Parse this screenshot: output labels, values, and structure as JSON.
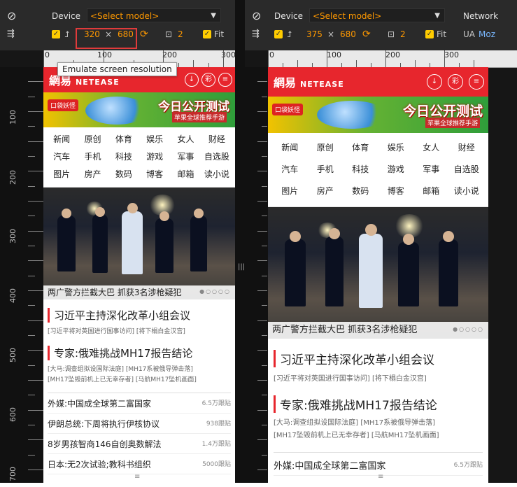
{
  "toolbar": {
    "device_label": "Device",
    "select_model": "<Select model>",
    "network_label": "Network",
    "ua_label": "UA",
    "ua_value": "Moz",
    "fit_label": "Fit",
    "times": "×"
  },
  "panes": [
    {
      "width": "320",
      "height": "680",
      "dpr": "2",
      "ruler_top": [
        "0",
        "100",
        "200",
        "300"
      ],
      "ruler_left": [
        "100",
        "200",
        "300",
        "400",
        "500",
        "600",
        "700"
      ]
    },
    {
      "width": "375",
      "height": "680",
      "dpr": "2",
      "ruler_top": [
        "0",
        "100",
        "200",
        "300"
      ],
      "ruler_left": [
        "100",
        "200",
        "300",
        "400",
        "500",
        "600",
        "700"
      ]
    }
  ],
  "tooltip": "Emulate screen resolution",
  "site": {
    "logo": "網易",
    "logo_en": "NETEASE",
    "header_icons": [
      "↓",
      "彩",
      "≡"
    ],
    "banner_title": "今日公开测试",
    "banner_sub": "苹果全球推荐手游",
    "banner_logo": "口袋妖怪",
    "nav": [
      "新闻",
      "原创",
      "体育",
      "娱乐",
      "女人",
      "财经",
      "汽车",
      "手机",
      "科技",
      "游戏",
      "军事",
      "自选股",
      "图片",
      "房产",
      "数码",
      "博客",
      "邮箱",
      "读小说"
    ],
    "photo_caption": "两广警方拦截大巴 抓获3名涉枪疑犯",
    "headline1": "习近平主持深化改革小组会议",
    "sub1": "[习近平将对英国进行国事访问] [将下榻白金汉宫]",
    "headline2": "专家:俄难挑战MH17报告结论",
    "sub2a": "[大马:调查组拟设国际法庭] [MH17系被俄导弹击落]",
    "sub2b": "[MH17坠毁前机上已无幸存者] [马航MH17坠机画面]",
    "list": [
      {
        "title": "外媒:中国成全球第二富国家",
        "count": "6.5万跟贴"
      },
      {
        "title": "伊朗总统:下周将执行伊核协议",
        "count": "938跟贴"
      },
      {
        "title": "8岁男孩智商146自创奥数解法",
        "count": "1.4万跟贴"
      },
      {
        "title": "日本:无2次试验;教科书组织",
        "count": "5000跟贴"
      }
    ]
  },
  "colors": {
    "brand_red": "#e7262d",
    "accent_orange": "#ff9900",
    "highlight_red": "#e03b3b"
  }
}
